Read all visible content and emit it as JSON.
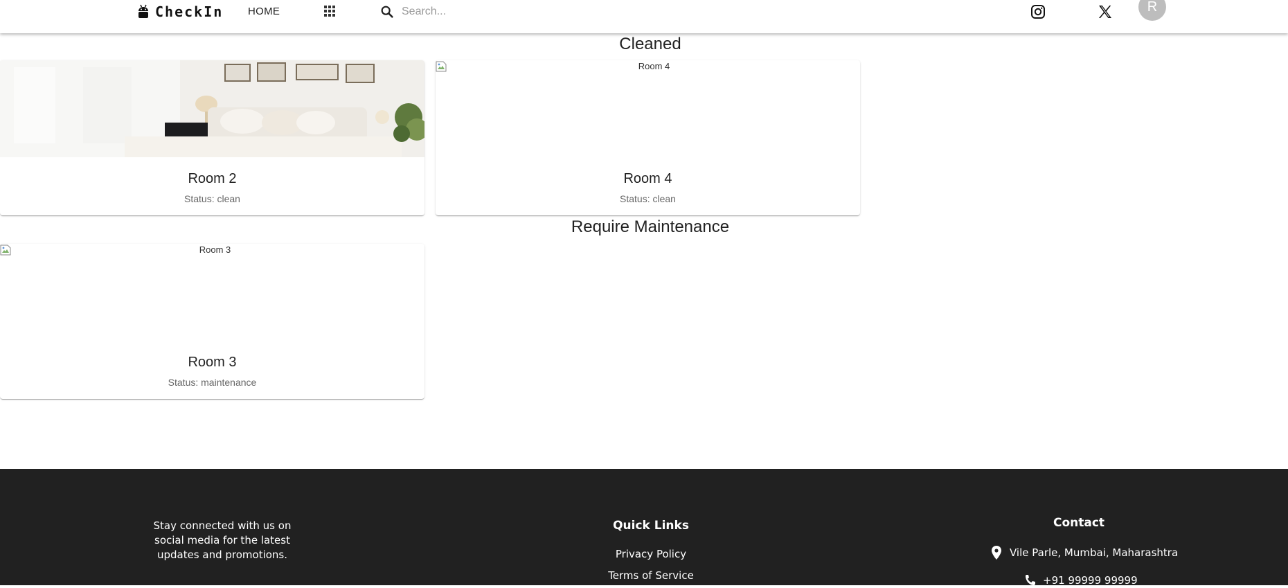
{
  "header": {
    "brand": "CheckIn",
    "nav_home": "HOME",
    "search_placeholder": "Search...",
    "avatar_initial": "R"
  },
  "sections": {
    "cleaned": {
      "title": "Cleaned",
      "rooms": [
        {
          "name": "Room 2",
          "status": "Status: clean",
          "image": "photo"
        },
        {
          "name": "Room 4",
          "status": "Status: clean",
          "image_alt": "Room 4"
        }
      ]
    },
    "maintenance": {
      "title": "Require Maintenance",
      "rooms": [
        {
          "name": "Room 3",
          "status": "Status: maintenance",
          "image_alt": "Room 3"
        }
      ]
    }
  },
  "footer": {
    "about": "Stay connected with us on social media for the latest updates and promotions.",
    "quick_links_title": "Quick Links",
    "links": [
      "Privacy Policy",
      "Terms of Service"
    ],
    "contact_title": "Contact",
    "address": "Vile Parle, Mumbai, Maharashtra",
    "phone": "+91 99999 99999"
  },
  "colors": {
    "footer_bg": "#212121",
    "avatar_bg": "#bdbdbd",
    "header_bg": "#ffffff"
  },
  "icons": [
    "android-logo-icon",
    "apps-grid-icon",
    "search-icon",
    "instagram-icon",
    "x-twitter-icon",
    "location-pin-icon",
    "phone-icon",
    "broken-image-icon"
  ]
}
